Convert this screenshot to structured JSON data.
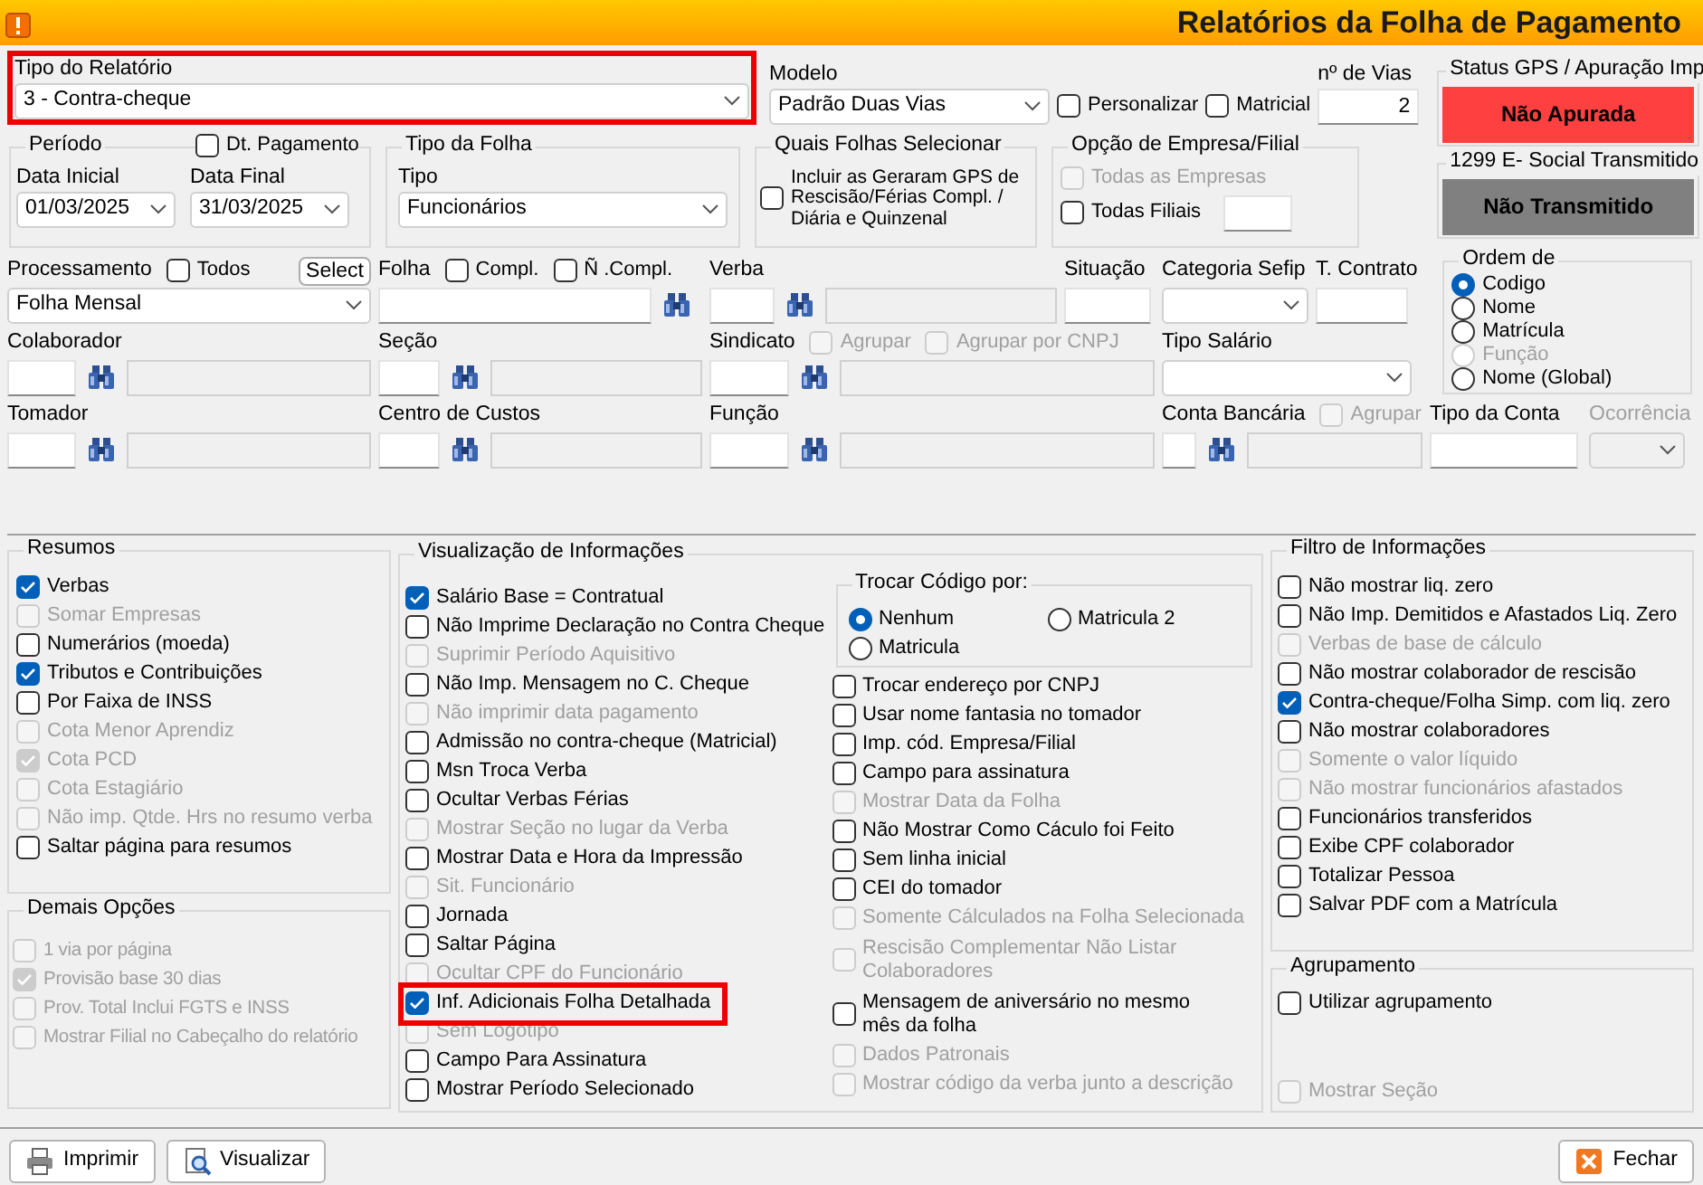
{
  "window": {
    "title": "Relatórios da Folha de Pagamento"
  },
  "report_type": {
    "label": "Tipo do Relatório",
    "value": "3 - Contra-cheque",
    "highlighted": true
  },
  "model": {
    "label": "Modelo",
    "value": "Padrão Duas Vias"
  },
  "model_options": [
    {
      "label": "Personalizar",
      "checked": false,
      "disabled": false
    },
    {
      "label": "Matricial",
      "checked": false,
      "disabled": false
    }
  ],
  "copies": {
    "label": "nº de Vias",
    "value": "2"
  },
  "period": {
    "label": "Período",
    "payment_date": {
      "label": "Dt. Pagamento",
      "checked": false,
      "disabled": false
    },
    "start": {
      "label": "Data Inicial",
      "value": "01/03/2025"
    },
    "end": {
      "label": "Data Final",
      "value": "31/03/2025"
    }
  },
  "payroll_type": {
    "label": "Tipo da Folha",
    "field_label": "Tipo",
    "value": "Funcionários"
  },
  "payroll_select": {
    "label": "Quais Folhas Selecionar",
    "option": {
      "label": "Incluir as Geraram GPS de Rescisão/Férias Compl. / Diária e Quinzenal",
      "checked": false,
      "disabled": false
    }
  },
  "company_option": {
    "label": "Opção de Empresa/Filial",
    "options": [
      {
        "label": "Todas as Empresas",
        "checked": false,
        "disabled": true
      },
      {
        "label": "Todas Filiais",
        "checked": false,
        "disabled": false
      }
    ]
  },
  "status_panels": [
    {
      "label": "Status GPS / Apuração Imp",
      "value": "Não Apurada",
      "color": "#ff4040"
    },
    {
      "label": "1299 E- Social Transmitido",
      "value": "Não Transmitido",
      "color": "#808080"
    }
  ],
  "filter_rows": [
    {
      "fields": [
        {
          "kind": "combo",
          "label": "Processamento",
          "value": "Folha Mensal",
          "disabled": false,
          "options": [
            {
              "label": "Todos",
              "checked": false,
              "disabled": false
            }
          ],
          "button": "Select"
        },
        {
          "kind": "search",
          "label": "Folha",
          "disabled": false,
          "options": [
            {
              "label": "Compl.",
              "checked": false,
              "disabled": false
            },
            {
              "label": "Ñ .Compl.",
              "checked": false,
              "disabled": false
            }
          ]
        },
        {
          "kind": "lookup",
          "label": "Verba",
          "disabled": false
        },
        {
          "kind": "text",
          "label": "Situação",
          "disabled": false
        },
        {
          "kind": "combo",
          "label": "Categoria Sefip",
          "disabled": false
        },
        {
          "kind": "text",
          "label": "T. Contrato",
          "disabled": false
        }
      ]
    },
    {
      "fields": [
        {
          "kind": "lookup",
          "label": "Colaborador",
          "disabled": false
        },
        {
          "kind": "lookup",
          "label": "Seção",
          "disabled": false
        },
        {
          "kind": "lookup",
          "label": "Sindicato",
          "disabled": false,
          "options": [
            {
              "label": "Agrupar",
              "checked": false,
              "disabled": true
            },
            {
              "label": "Agrupar por CNPJ",
              "checked": false,
              "disabled": true
            }
          ]
        },
        {
          "kind": "combo",
          "label": "Tipo Salário",
          "disabled": false
        }
      ]
    },
    {
      "fields": [
        {
          "kind": "lookup",
          "label": "Tomador",
          "disabled": false
        },
        {
          "kind": "lookup",
          "label": "Centro de Custos",
          "disabled": false
        },
        {
          "kind": "lookup",
          "label": "Função",
          "disabled": false
        },
        {
          "kind": "lookup",
          "label": "Conta Bancária",
          "disabled": false,
          "options": [
            {
              "label": "Agrupar",
              "checked": false,
              "disabled": true
            }
          ]
        },
        {
          "kind": "text",
          "label": "Tipo da Conta",
          "disabled": false
        },
        {
          "kind": "combo",
          "label": "Ocorrência",
          "disabled": true
        }
      ]
    }
  ],
  "ordering": {
    "label": "Ordem de",
    "options": [
      {
        "label": "Codigo",
        "selected": true,
        "disabled": false
      },
      {
        "label": "Nome",
        "selected": false,
        "disabled": false
      },
      {
        "label": "Matrícula",
        "selected": false,
        "disabled": false
      },
      {
        "label": "Função",
        "selected": false,
        "disabled": true
      },
      {
        "label": "Nome (Global)",
        "selected": false,
        "disabled": false
      }
    ]
  },
  "summaries": {
    "label": "Resumos",
    "items": [
      {
        "label": "Verbas",
        "checked": true,
        "disabled": false
      },
      {
        "label": "Somar Empresas",
        "checked": false,
        "disabled": true
      },
      {
        "label": "Numerários (moeda)",
        "checked": false,
        "disabled": false
      },
      {
        "label": "Tributos e Contribuições",
        "checked": true,
        "disabled": false
      },
      {
        "label": "Por Faixa de INSS",
        "checked": false,
        "disabled": false
      },
      {
        "label": "Cota Menor Aprendiz",
        "checked": false,
        "disabled": true
      },
      {
        "label": "Cota PCD",
        "checked": true,
        "disabled": true
      },
      {
        "label": "Cota Estagiário",
        "checked": false,
        "disabled": true
      },
      {
        "label": "Não imp. Qtde. Hrs no resumo verba",
        "checked": false,
        "disabled": true
      },
      {
        "label": "Saltar página para resumos",
        "checked": false,
        "disabled": false
      }
    ]
  },
  "other_options": {
    "label": "Demais Opções",
    "items": [
      {
        "label": "1 via por página",
        "checked": false,
        "disabled": true
      },
      {
        "label": "Provisão base 30 dias",
        "checked": true,
        "disabled": true
      },
      {
        "label": "Prov. Total Inclui FGTS e INSS",
        "checked": false,
        "disabled": true
      },
      {
        "label": "Mostrar Filial no Cabeçalho do relatório",
        "checked": false,
        "disabled": true
      }
    ]
  },
  "display": {
    "label": "Visualização de Informações",
    "left_items": [
      {
        "label": "Salário Base = Contratual",
        "checked": true,
        "disabled": false,
        "highlighted": false
      },
      {
        "label": "Não Imprime Declaração no Contra Cheque",
        "checked": false,
        "disabled": false,
        "highlighted": false
      },
      {
        "label": "Suprimir Período Aquisitivo",
        "checked": false,
        "disabled": true,
        "highlighted": false
      },
      {
        "label": "Não Imp. Mensagem no C. Cheque",
        "checked": false,
        "disabled": false,
        "highlighted": false
      },
      {
        "label": "Não imprimir data pagamento",
        "checked": false,
        "disabled": true,
        "highlighted": false
      },
      {
        "label": "Admissão no contra-cheque (Matricial)",
        "checked": false,
        "disabled": false,
        "highlighted": false
      },
      {
        "label": "Msn Troca Verba",
        "checked": false,
        "disabled": false,
        "highlighted": false
      },
      {
        "label": "Ocultar Verbas Férias",
        "checked": false,
        "disabled": false,
        "highlighted": false
      },
      {
        "label": "Mostrar Seção no lugar da Verba",
        "checked": false,
        "disabled": true,
        "highlighted": false
      },
      {
        "label": "Mostrar Data e Hora da Impressão",
        "checked": false,
        "disabled": false,
        "highlighted": false
      },
      {
        "label": "Sit. Funcionário",
        "checked": false,
        "disabled": true,
        "highlighted": false
      },
      {
        "label": "Jornada",
        "checked": false,
        "disabled": false,
        "highlighted": false
      },
      {
        "label": "Saltar Página",
        "checked": false,
        "disabled": false,
        "highlighted": false
      },
      {
        "label": "Ocultar CPF do Funcionário",
        "checked": false,
        "disabled": true,
        "highlighted": false
      },
      {
        "label": "Inf. Adicionais Folha Detalhada",
        "checked": true,
        "disabled": false,
        "highlighted": true
      },
      {
        "label": "Sem Logotipo",
        "checked": false,
        "disabled": true,
        "highlighted": false
      },
      {
        "label": "Campo Para Assinatura",
        "checked": false,
        "disabled": false,
        "highlighted": false
      },
      {
        "label": "Mostrar Período Selecionado",
        "checked": false,
        "disabled": false,
        "highlighted": false
      }
    ],
    "code_swap": {
      "label": "Trocar Código por:",
      "options": [
        {
          "label": "Nenhum",
          "selected": true
        },
        {
          "label": "Matricula 2",
          "selected": false
        },
        {
          "label": "Matricula",
          "selected": false
        }
      ]
    },
    "right_items": [
      {
        "label": "Trocar endereço por CNPJ",
        "checked": false,
        "disabled": false
      },
      {
        "label": "Usar nome fantasia no tomador",
        "checked": false,
        "disabled": false
      },
      {
        "label": "Imp. cód. Empresa/Filial",
        "checked": false,
        "disabled": false
      },
      {
        "label": "Campo para assinatura",
        "checked": false,
        "disabled": false
      },
      {
        "label": "Mostrar Data da Folha",
        "checked": false,
        "disabled": true
      },
      {
        "label": "Não Mostrar Como Cáculo foi Feito",
        "checked": false,
        "disabled": false
      },
      {
        "label": "Sem linha inicial",
        "checked": false,
        "disabled": false
      },
      {
        "label": "CEI do tomador",
        "checked": false,
        "disabled": false
      },
      {
        "label": "Somente Cálculados na Folha Selecionada",
        "checked": false,
        "disabled": true
      },
      {
        "label": "Rescisão Complementar Não Listar Colaboradores",
        "checked": false,
        "disabled": true
      },
      {
        "label": "Mensagem de aniversário no mesmo mês da folha",
        "checked": false,
        "disabled": false
      },
      {
        "label": "Dados Patronais",
        "checked": false,
        "disabled": true
      },
      {
        "label": "Mostrar código da verba junto a descrição",
        "checked": false,
        "disabled": true
      }
    ]
  },
  "info_filter": {
    "label": "Filtro de Informações",
    "items": [
      {
        "label": "Não mostrar liq. zero",
        "checked": false,
        "disabled": false
      },
      {
        "label": "Não Imp. Demitidos e Afastados Liq. Zero",
        "checked": false,
        "disabled": false
      },
      {
        "label": "Verbas de base de cálculo",
        "checked": false,
        "disabled": true
      },
      {
        "label": "Não mostrar colaborador de rescisão",
        "checked": false,
        "disabled": false
      },
      {
        "label": "Contra-cheque/Folha Simp. com liq. zero",
        "checked": true,
        "disabled": false
      },
      {
        "label": "Não mostrar colaboradores",
        "checked": false,
        "disabled": false
      },
      {
        "label": "Somente o valor líquido",
        "checked": false,
        "disabled": true
      },
      {
        "label": "Não mostrar funcionários afastados",
        "checked": false,
        "disabled": true
      },
      {
        "label": "Funcionários transferidos",
        "checked": false,
        "disabled": false
      },
      {
        "label": "Exibe CPF colaborador",
        "checked": false,
        "disabled": false
      },
      {
        "label": "Totalizar Pessoa",
        "checked": false,
        "disabled": false
      },
      {
        "label": "Salvar PDF com a Matrícula",
        "checked": false,
        "disabled": false
      }
    ]
  },
  "grouping": {
    "label": "Agrupamento",
    "items": [
      {
        "label": "Utilizar agrupamento",
        "checked": false,
        "disabled": false
      },
      {
        "label": "Mostrar Seção",
        "checked": false,
        "disabled": true
      }
    ]
  },
  "buttons": [
    {
      "label": "Imprimir",
      "kind": "print"
    },
    {
      "label": "Visualizar",
      "kind": "preview"
    },
    {
      "label": "Fechar",
      "kind": "close"
    }
  ]
}
